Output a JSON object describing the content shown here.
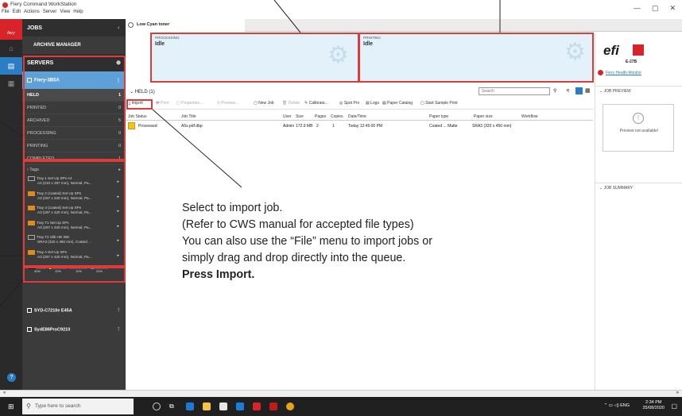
{
  "titlebar": {
    "app_title": "Fiery Command WorkStation",
    "menu": [
      "File",
      "Edit",
      "Actions",
      "Server",
      "View",
      "Help"
    ],
    "window_controls": [
      "—",
      "▢",
      "✕"
    ]
  },
  "rail": {
    "brand": "fiery"
  },
  "sidebar": {
    "jobs_label": "JOBS",
    "archive_manager": "ARCHIVE MANAGER",
    "servers_label": "SERVERS",
    "server": {
      "name": "Fiery-3B5A"
    },
    "queues": [
      {
        "label": "HELD",
        "count": "1"
      },
      {
        "label": "PRINTED",
        "count": "0"
      },
      {
        "label": "ARCHIVED",
        "count": "5"
      },
      {
        "label": "PROCESSING",
        "count": "0"
      },
      {
        "label": "PRINTING",
        "count": "0"
      },
      {
        "label": "COMPLETED",
        "count": "1"
      }
    ],
    "tags_label": "Tags",
    "trays": [
      {
        "line1": "Tray 1 Set Up SPs A4",
        "line2": "A4 (210 x 297 mm), Normal, Pa...",
        "warn": false
      },
      {
        "line1": "Tray 2 (coated) Set Up SPs",
        "line2": "A3 (297 x 420 mm), Normal, Pa...",
        "warn": true
      },
      {
        "line1": "Tray 3 (coated) Set Up SPs",
        "line2": "A3 (297 x 420 mm), Normal, Pa...",
        "warn": true
      },
      {
        "line1": "Tray T1 Set Up SPs",
        "line2": "A3 (297 x 420 mm), Normal, Pa...",
        "warn": true
      },
      {
        "line1": "Tray T2 Silk HD 350",
        "line2": "SRA3 (320 x 450 mm), Coated ...",
        "warn": false
      },
      {
        "line1": "Tray A Set Up SPs",
        "line2": "A3 (297 x 420 mm), Normal, Pa...",
        "warn": true
      }
    ],
    "toner": {
      "labels": [
        "40%",
        "10%",
        "10%",
        "20%"
      ],
      "colors": [
        "#111111",
        "#f1e216",
        "#e0207a",
        "#1fa3e0"
      ],
      "levels": [
        0.4,
        0.1,
        0.1,
        0.2
      ]
    },
    "other_servers": [
      "SYD-C7210e E45A",
      "SydE86ProC9210"
    ]
  },
  "tab": {
    "label": "Low Cyan toner"
  },
  "processing": {
    "label": "PROCESSING",
    "value": "Idle"
  },
  "printing": {
    "label": "PRINTING",
    "value": "Idle"
  },
  "queue": {
    "title": "HELD (1)",
    "search_placeholder": "Search"
  },
  "toolbar": {
    "import": "Import",
    "print": "Print",
    "properties": "Properties...",
    "preview": "Preview...",
    "new_job": "New Job",
    "delete": "Delete",
    "calibrate": "Calibrate...",
    "spot_pro": "Spot Pro",
    "logs": "Logs",
    "paper_catalog": "Paper Catalog",
    "start_sample": "Start Sample Print"
  },
  "columns": [
    "Job Status",
    "Job Title",
    "User",
    "Size",
    "Pages",
    "Copies",
    "Date/Time",
    "Paper type",
    "Paper size",
    "Workflow"
  ],
  "job": {
    "status": "Processed",
    "title": "A5s.pdf.dbp",
    "user": "Admin",
    "size": "172.9 MB",
    "pages": "2",
    "copies": "1",
    "datetime": "Today 12:45:00 PM",
    "paper_type": "Coated ... Matte",
    "paper_size": "SRA3 (320 x 450 mm)",
    "workflow": ""
  },
  "right_panel": {
    "brand": "efi",
    "model": "E-27B",
    "health_monitor": "Fiery Health Monitor",
    "job_preview": "JOB PREVIEW",
    "preview_msg": "Preview not available!",
    "job_summary": "JOB SUMMARY"
  },
  "instructions": {
    "line1": "Select to import job.",
    "line2": "(Refer to CWS manual for accepted file types)",
    "line3": "You can also use the “File” menu to import jobs or",
    "line4": "simply drag and drop directly into the queue.",
    "line5": "Press Import."
  },
  "taskbar": {
    "search_placeholder": "Type here to search",
    "time": "2:34 PM",
    "date": "25/08/2020",
    "lang": "ENG"
  },
  "statusbar": {
    "left": "«",
    "right": "»"
  }
}
